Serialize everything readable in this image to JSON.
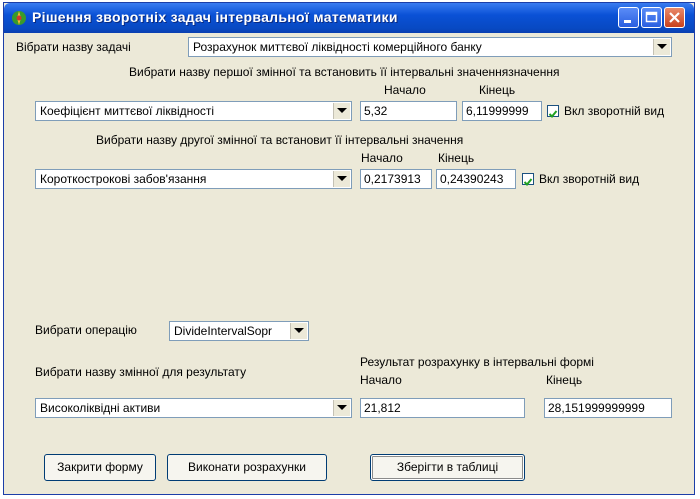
{
  "window": {
    "title": "Рішення зворотніх задач інтервальної математики"
  },
  "task": {
    "label": "Вібрати назву задачі",
    "selected": "Розрахунок миттєвої ліквідності комерційного банку"
  },
  "first_var": {
    "header": "Вибрати назву першої змінної та встановить її інтервальні значеннязначення",
    "start_label": "Начало",
    "end_label": "Кінець",
    "selected": "Коефіцієнт миттєвої ліквідності",
    "start_value": "5,32",
    "end_value": "6,11999999",
    "inverse_label": "Вкл зворотній вид",
    "inverse_checked": true
  },
  "second_var": {
    "header": "Вибрати назву другої змінної та встановит її інтервальні значення",
    "start_label": "Начало",
    "end_label": "Кінець",
    "selected": "Короткострокові забов'язання",
    "start_value": "0,2173913",
    "end_value": "0,24390243",
    "inverse_label": "Вкл зворотній вид",
    "inverse_checked": true
  },
  "operation": {
    "label": "Вибрати операцію",
    "selected": "DivideIntervalSopr"
  },
  "result": {
    "var_label": "Вибрати назву змінної для результату",
    "header": "Результат розрахунку в інтервальні формі",
    "start_label": "Начало",
    "end_label": "Кінець",
    "selected": "Високоліквідні активи",
    "start_value": "21,812",
    "end_value": "28,151999999999"
  },
  "buttons": {
    "close_form": "Закрити форму",
    "calculate": "Виконати розрахунки",
    "save_table": "Зберігти в таблиці"
  },
  "icons": {
    "app": "app-icon",
    "minimize": "minimize-icon",
    "maximize": "maximize-icon",
    "close": "close-icon",
    "dropdown": "chevron-down-icon",
    "check": "check-icon"
  },
  "colors": {
    "titlebar": "#0a51d6",
    "window_bg": "#ece9d8",
    "close_button": "#c8411c"
  }
}
